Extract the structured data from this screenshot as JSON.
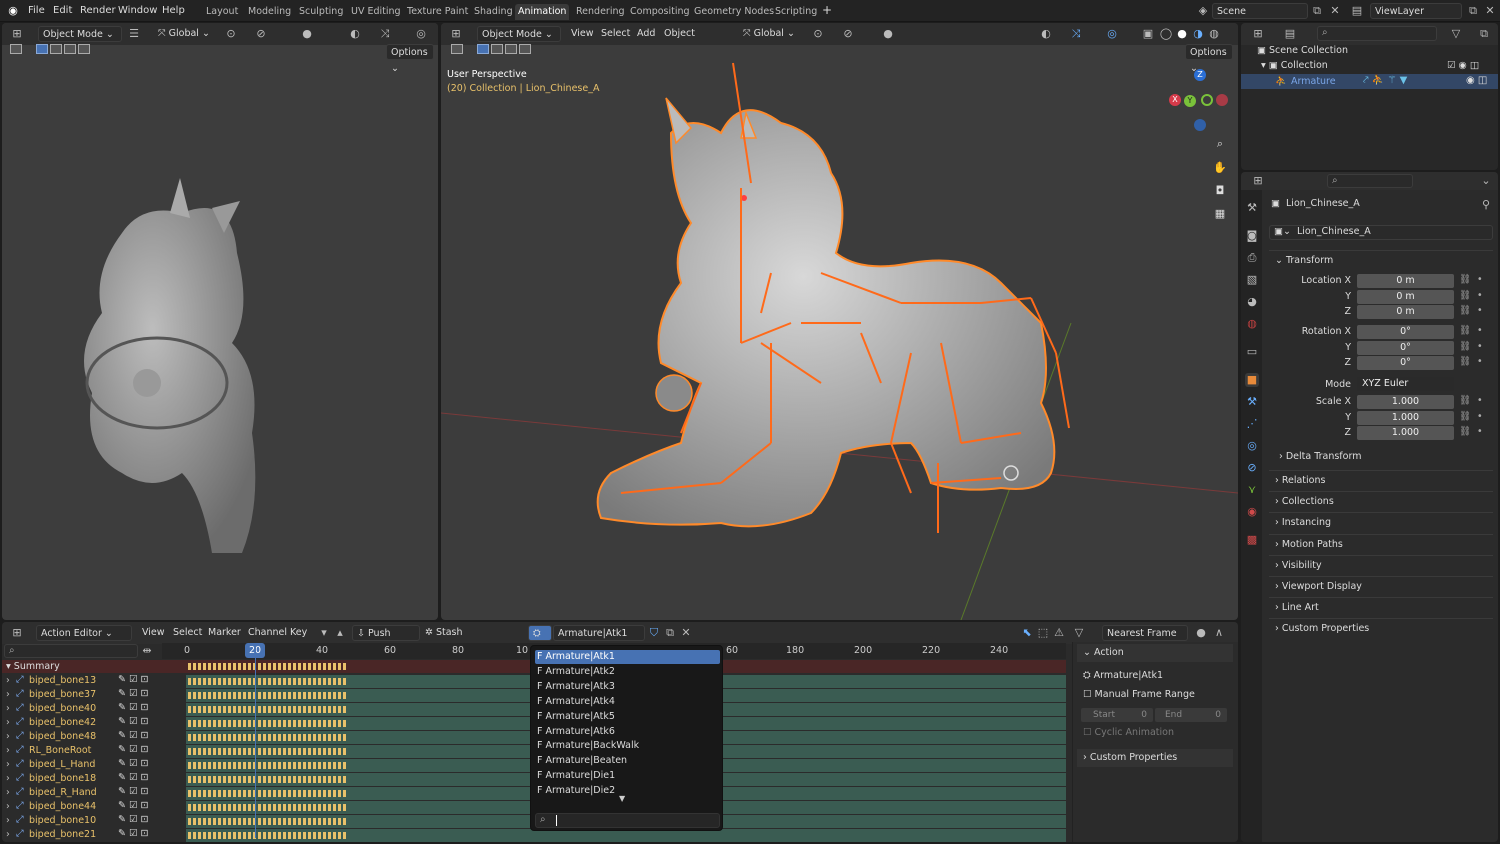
{
  "menu": [
    "File",
    "Edit",
    "Render",
    "Window",
    "Help"
  ],
  "workspaces": [
    "Layout",
    "Modeling",
    "Sculpting",
    "UV Editing",
    "Texture Paint",
    "Shading",
    "Animation",
    "Rendering",
    "Compositing",
    "Geometry Nodes",
    "Scripting"
  ],
  "active_workspace": "Animation",
  "scene": "Scene",
  "view_layer": "ViewLayer",
  "left_vp": {
    "mode": "Object Mode",
    "orientation": "Global",
    "options": "Options"
  },
  "main_vp": {
    "mode": "Object Mode",
    "menus": [
      "View",
      "Select",
      "Add",
      "Object"
    ],
    "orientation": "Global",
    "options": "Options",
    "perspective": "User Perspective",
    "collection": "(20) Collection | Lion_Chinese_A"
  },
  "outliner": {
    "scene_collection": "Scene Collection",
    "collection": "Collection",
    "armature": "Armature"
  },
  "props": {
    "object_name": "Lion_Chinese_A",
    "object_field": "Lion_Chinese_A",
    "transform": "Transform",
    "location": [
      {
        "label": "Location X",
        "value": "0 m"
      },
      {
        "label": "Y",
        "value": "0 m"
      },
      {
        "label": "Z",
        "value": "0 m"
      }
    ],
    "rotation": [
      {
        "label": "Rotation X",
        "value": "0°"
      },
      {
        "label": "Y",
        "value": "0°"
      },
      {
        "label": "Z",
        "value": "0°"
      }
    ],
    "mode_label": "Mode",
    "mode_value": "XYZ Euler",
    "scale": [
      {
        "label": "Scale X",
        "value": "1.000"
      },
      {
        "label": "Y",
        "value": "1.000"
      },
      {
        "label": "Z",
        "value": "1.000"
      }
    ],
    "delta": "Delta Transform",
    "sections": [
      "Relations",
      "Collections",
      "Instancing",
      "Motion Paths",
      "Visibility",
      "Viewport Display",
      "Line Art",
      "Custom Properties"
    ]
  },
  "action_editor": {
    "editor": "Action Editor",
    "menus": [
      "View",
      "Select",
      "Marker",
      "Channel",
      "Key"
    ],
    "push_down": "Push Down",
    "stash": "Stash",
    "action": "Armature|Atk1",
    "snap": "Nearest Frame",
    "frames": [
      "0",
      "20",
      "40",
      "60",
      "80",
      "10",
      "60",
      "180",
      "200",
      "220",
      "240"
    ],
    "current_frame": "20",
    "summary": "Summary",
    "channels": [
      "biped_bone13",
      "biped_bone37",
      "biped_bone40",
      "biped_bone42",
      "biped_bone48",
      "RL_BoneRoot",
      "biped_L_Hand",
      "biped_bone18",
      "biped_R_Hand",
      "biped_bone44",
      "biped_bone10",
      "biped_bone21"
    ]
  },
  "side_panel": {
    "action_hdr": "Action",
    "action_name": "Armature|Atk1",
    "manual": "Manual Frame Range",
    "start_label": "Start",
    "start_val": "0",
    "end_label": "End",
    "end_val": "0",
    "cyclic": "Cyclic Animation",
    "custom": "Custom Properties"
  },
  "dropdown": {
    "items": [
      "F Armature|Atk1",
      "F Armature|Atk2",
      "F Armature|Atk3",
      "F Armature|Atk4",
      "F Armature|Atk5",
      "F Armature|Atk6",
      "F Armature|BackWalk",
      "F Armature|Beaten",
      "F Armature|Die1",
      "F Armature|Die2"
    ],
    "selected": 0
  }
}
